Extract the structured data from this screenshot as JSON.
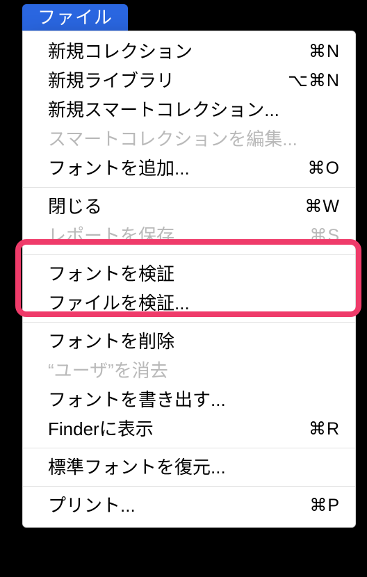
{
  "menu": {
    "title": "ファイル",
    "groups": [
      [
        {
          "label": "新規コレクション",
          "shortcut": "⌘N",
          "disabled": false
        },
        {
          "label": "新規ライブラリ",
          "shortcut": "⌥⌘N",
          "disabled": false
        },
        {
          "label": "新規スマートコレクション...",
          "shortcut": "",
          "disabled": false
        },
        {
          "label": "スマートコレクションを編集...",
          "shortcut": "",
          "disabled": true
        },
        {
          "label": "フォントを追加...",
          "shortcut": "⌘O",
          "disabled": false
        }
      ],
      [
        {
          "label": "閉じる",
          "shortcut": "⌘W",
          "disabled": false
        },
        {
          "label": "レポートを保存...",
          "shortcut": "⌘S",
          "disabled": true
        }
      ],
      [
        {
          "label": "フォントを検証",
          "shortcut": "",
          "disabled": false
        },
        {
          "label": "ファイルを検証...",
          "shortcut": "",
          "disabled": false
        }
      ],
      [
        {
          "label": "フォントを削除",
          "shortcut": "",
          "disabled": false
        },
        {
          "label": "“ユーザ”を消去",
          "shortcut": "",
          "disabled": true
        },
        {
          "label": "フォントを書き出す...",
          "shortcut": "",
          "disabled": false
        },
        {
          "label": "Finderに表示",
          "shortcut": "⌘R",
          "disabled": false
        }
      ],
      [
        {
          "label": "標準フォントを復元...",
          "shortcut": "",
          "disabled": false
        }
      ],
      [
        {
          "label": "プリント...",
          "shortcut": "⌘P",
          "disabled": false
        }
      ]
    ]
  }
}
